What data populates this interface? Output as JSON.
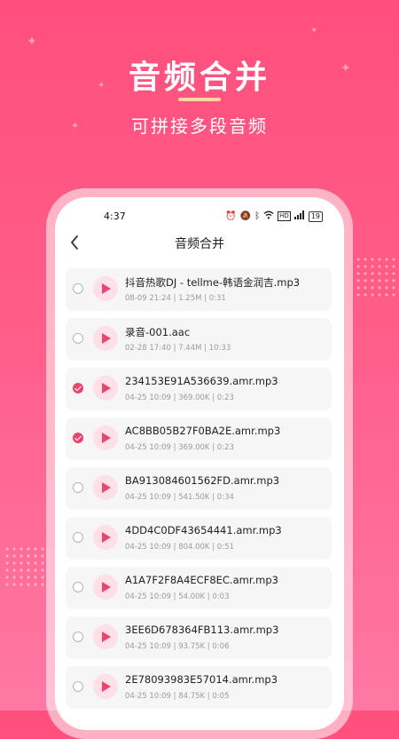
{
  "promo": {
    "title": "音频合并",
    "subtitle": "可拼接多段音频"
  },
  "statusbar": {
    "time": "4:37",
    "icons": [
      "alarm-icon",
      "mute-icon",
      "bluetooth-icon",
      "wifi-icon",
      "hd-icon",
      "signal-icon"
    ],
    "battery": "19"
  },
  "header": {
    "title": "音频合并",
    "back_icon": "chevron-left-icon"
  },
  "colors": {
    "accent": "#e8466e",
    "play_bg": "#ffdfe8",
    "gradient_top": "#ff4f7d",
    "gradient_bottom": "#ff78a4"
  },
  "files": [
    {
      "name": "抖音热歌DJ - tellme-韩语金润吉.mp3",
      "date": "08-09 21:24",
      "size": "1.25M",
      "duration": "0:31",
      "checked": false
    },
    {
      "name": "录音-001.aac",
      "date": "02-28 17:40",
      "size": "7.44M",
      "duration": "10:33",
      "checked": false
    },
    {
      "name": "234153E91A536639.amr.mp3",
      "date": "04-25 10:09",
      "size": "369.00K",
      "duration": "0:23",
      "checked": true
    },
    {
      "name": "AC8BB05B27F0BA2E.amr.mp3",
      "date": "04-25 10:09",
      "size": "369.00K",
      "duration": "0:23",
      "checked": true
    },
    {
      "name": "BA913084601562FD.amr.mp3",
      "date": "04-25 10:09",
      "size": "541.50K",
      "duration": "0:34",
      "checked": false
    },
    {
      "name": "4DD4C0DF43654441.amr.mp3",
      "date": "04-25 10:09",
      "size": "804.00K",
      "duration": "0:51",
      "checked": false
    },
    {
      "name": "A1A7F2F8A4ECF8EC.amr.mp3",
      "date": "04-25 10:09",
      "size": "54.00K",
      "duration": "0:03",
      "checked": false
    },
    {
      "name": "3EE6D678364FB113.amr.mp3",
      "date": "04-25 10:09",
      "size": "93.75K",
      "duration": "0:06",
      "checked": false
    },
    {
      "name": "2E78093983E57014.amr.mp3",
      "date": "04-25 10:09",
      "size": "84.75K",
      "duration": "0:05",
      "checked": false
    }
  ]
}
